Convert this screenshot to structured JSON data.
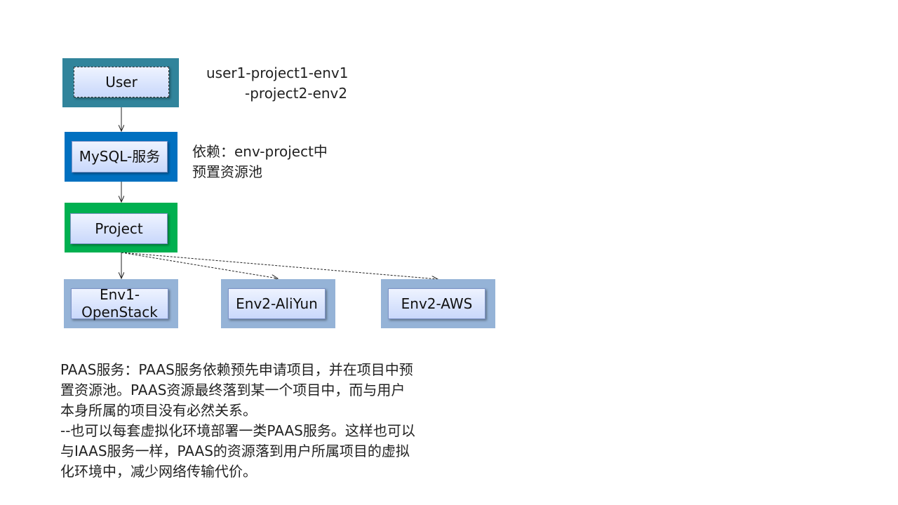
{
  "nodes": {
    "user": "User",
    "mysql": "MySQL-服务",
    "project": "Project",
    "env1": "Env1-OpenStack",
    "env2_aliyun": "Env2-AliYun",
    "env2_aws": "Env2-AWS"
  },
  "notes": {
    "user_line_1": "user1-project1-env1",
    "user_line_2": "-project2-env2",
    "dependency_line_1": "依赖：env-project中",
    "dependency_line_2": "预置资源池"
  },
  "description": [
    "PAAS服务：PAAS服务依赖预先申请项目，并在项目中预",
    "置资源池。PAAS资源最终落到某一个项目中，而与用户",
    "本身所属的项目没有必然关系。",
    "--也可以每套虚拟化环境部署一类PAAS服务。这样也可以",
    "与IAAS服务一样，PAAS的资源落到用户所属项目的虚拟",
    "化环境中，减少网络传输代价。"
  ],
  "colors": {
    "user_box": "#31849b",
    "mysql_box": "#0070c0",
    "project_box": "#00b050",
    "env_box": "#95b3d7"
  }
}
